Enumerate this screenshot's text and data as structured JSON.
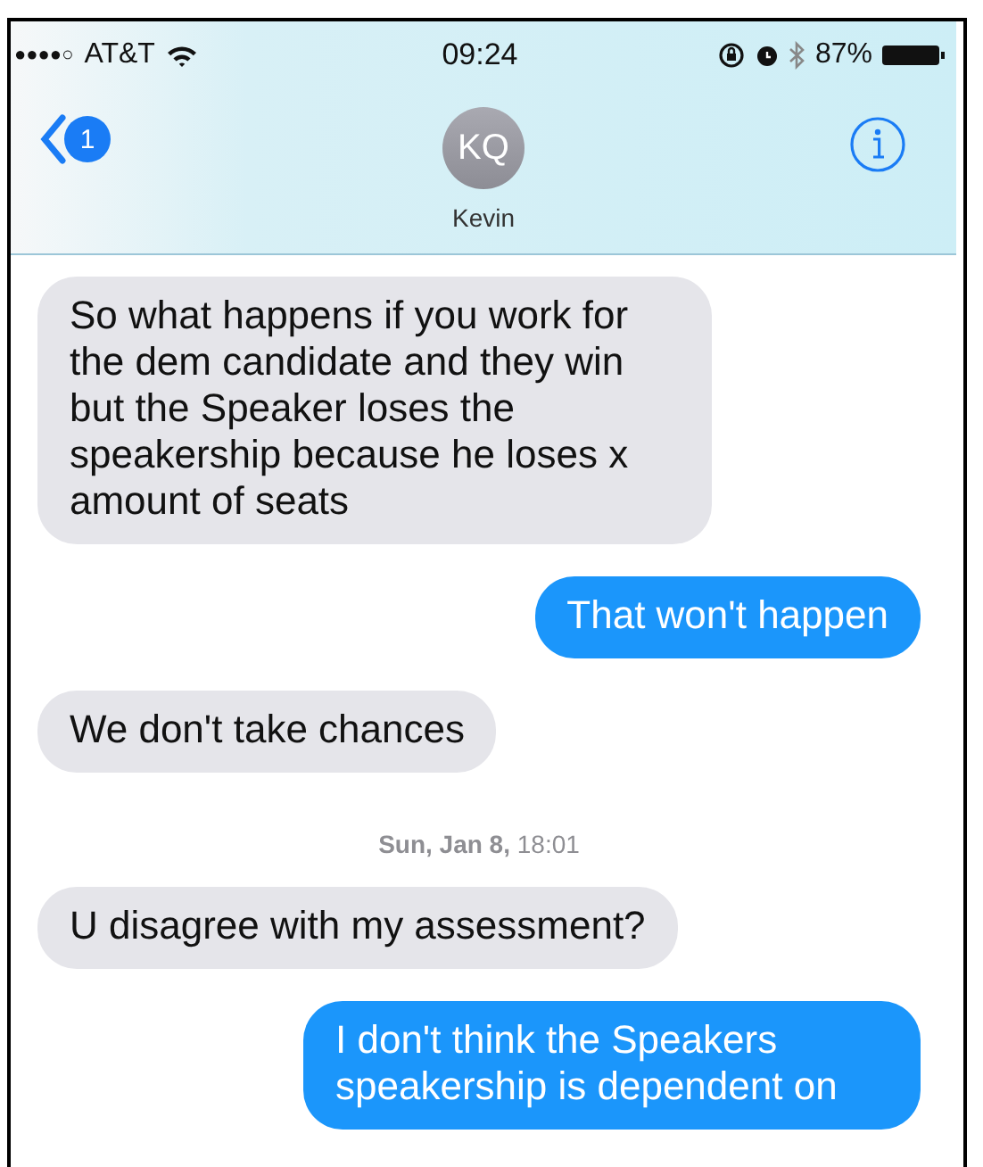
{
  "status_bar": {
    "signal_dots": "●●●●○",
    "carrier": "AT&T",
    "time": "09:24",
    "battery": "87%"
  },
  "nav": {
    "back_badge": "1",
    "avatar_initials": "KQ",
    "contact_name": "Kevin"
  },
  "messages": [
    {
      "kind": "received",
      "text": "So what happens if you work for the dem candidate and they win but the Speaker loses the speakership because he loses x amount of seats"
    },
    {
      "kind": "sent",
      "text": "That won't happen"
    },
    {
      "kind": "received",
      "text": "We don't take chances"
    },
    {
      "kind": "timestamp",
      "text": "**Sun, Jan 8,** 18:01"
    },
    {
      "kind": "received",
      "text": "U disagree with my assessment?"
    },
    {
      "kind": "sent",
      "text": "I don't think the Speakers speakership is dependent on"
    }
  ]
}
